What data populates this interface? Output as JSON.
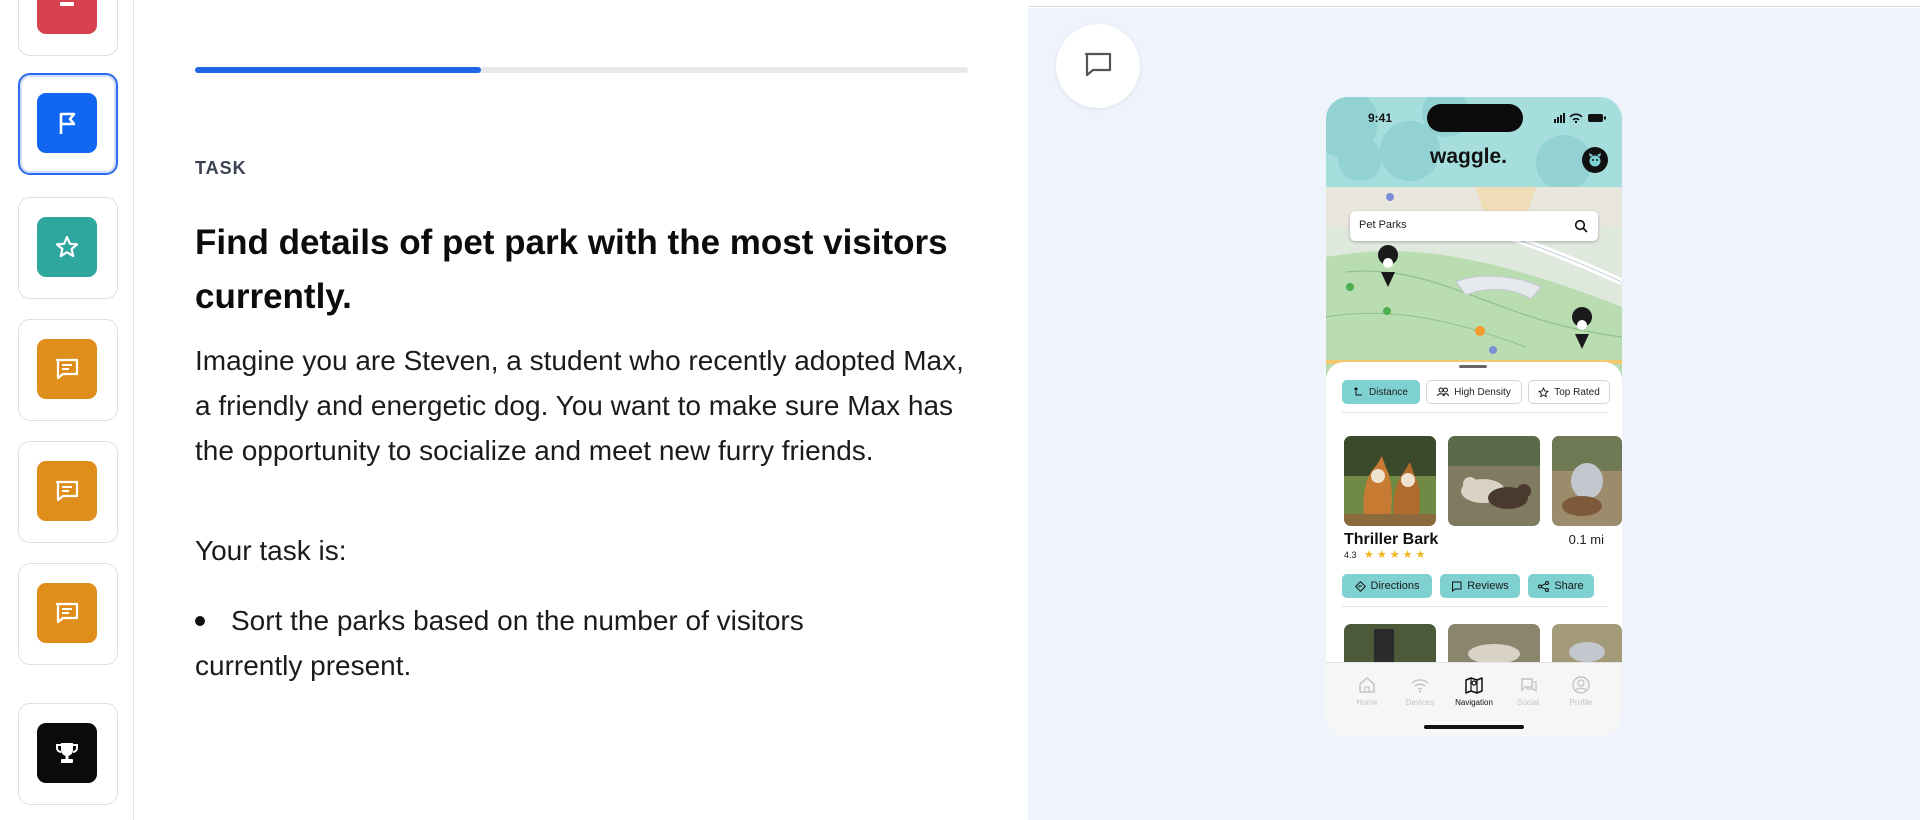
{
  "rail": {
    "items": [
      {
        "name": "rail-item-red",
        "color": "#d6434f",
        "icon": "minus-icon"
      },
      {
        "name": "rail-item-flag",
        "color": "#1166f2",
        "icon": "flag-icon",
        "active": true
      },
      {
        "name": "rail-item-star",
        "color": "#2ea79e",
        "icon": "star-icon"
      },
      {
        "name": "rail-item-message-1",
        "color": "#df8e1c",
        "icon": "message-icon"
      },
      {
        "name": "rail-item-message-2",
        "color": "#df8e1c",
        "icon": "message-icon"
      },
      {
        "name": "rail-item-message-3",
        "color": "#df8e1c",
        "icon": "message-icon"
      },
      {
        "name": "rail-item-trophy",
        "color": "#0b0b0b",
        "icon": "trophy-icon"
      }
    ]
  },
  "task": {
    "progress_percent": 37,
    "label": "TASK",
    "title": "Find details of pet park with the most visitors currently.",
    "description": "Imagine you are Steven, a student who recently adopted Max, a friendly and energetic dog. You want to make sure Max has the opportunity to socialize and meet new furry friends.",
    "subheading": "Your task is:",
    "steps": [
      "Sort the parks based on the number of visitors currently present."
    ]
  },
  "preview": {
    "chat_icon": "chat-bubble-icon",
    "phone": {
      "time": "9:41",
      "brand": "waggle.",
      "search_value": "Pet Parks",
      "filters": [
        {
          "label": "Distance",
          "active": true,
          "icon": "distance-icon"
        },
        {
          "label": "High Density",
          "active": false,
          "icon": "people-icon"
        },
        {
          "label": "Top Rated",
          "active": false,
          "icon": "star-outline-icon"
        }
      ],
      "park": {
        "name": "Thriller Bark",
        "distance": "0.1 mi",
        "rating": "4.3",
        "stars_filled": 4.3
      },
      "actions": [
        {
          "label": "Directions",
          "icon": "directions-icon"
        },
        {
          "label": "Reviews",
          "icon": "reviews-icon"
        },
        {
          "label": "Share",
          "icon": "share-icon"
        }
      ],
      "tabs": [
        {
          "label": "Home",
          "icon": "home-icon",
          "active": false
        },
        {
          "label": "Devices",
          "icon": "wifi-icon",
          "active": false
        },
        {
          "label": "Navigation",
          "icon": "map-icon",
          "active": true
        },
        {
          "label": "Social",
          "icon": "chat-icon",
          "active": false
        },
        {
          "label": "Profile",
          "icon": "profile-icon",
          "active": false
        }
      ]
    }
  }
}
